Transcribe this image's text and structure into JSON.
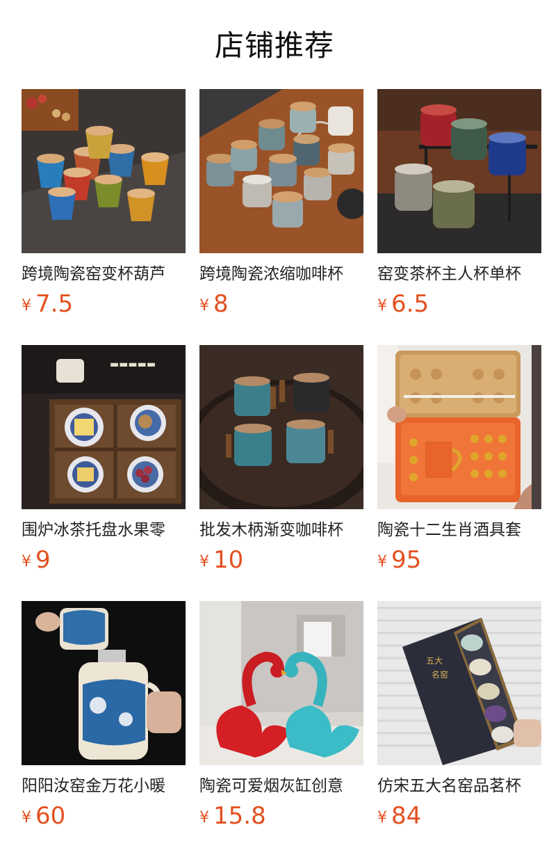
{
  "section_title": "店铺推荐",
  "currency_symbol": "¥",
  "accent_color": "#e4501f",
  "products": [
    {
      "name": "跨境陶瓷窑变杯葫芦",
      "price": "7.5",
      "image": "kiln-cups-latte"
    },
    {
      "name": "跨境陶瓷浓缩咖啡杯",
      "price": "8",
      "image": "espresso-cups"
    },
    {
      "name": "窑变茶杯主人杯单杯",
      "price": "6.5",
      "image": "kiln-tea-cups"
    },
    {
      "name": "围炉冰茶托盘水果零",
      "price": "9",
      "image": "snack-tray"
    },
    {
      "name": "批发木柄渐变咖啡杯",
      "price": "10",
      "image": "wood-handle-mugs"
    },
    {
      "name": "陶瓷十二生肖酒具套",
      "price": "95",
      "image": "zodiac-wine-set"
    },
    {
      "name": "阳阳汝窑金万花小暖",
      "price": "60",
      "image": "blue-flower-pot"
    },
    {
      "name": "陶瓷可爱烟灰缸创意",
      "price": "15.8",
      "image": "swan-ashtrays"
    },
    {
      "name": "仿宋五大名窑品茗杯",
      "price": "84",
      "image": "song-kiln-cup-set"
    }
  ]
}
